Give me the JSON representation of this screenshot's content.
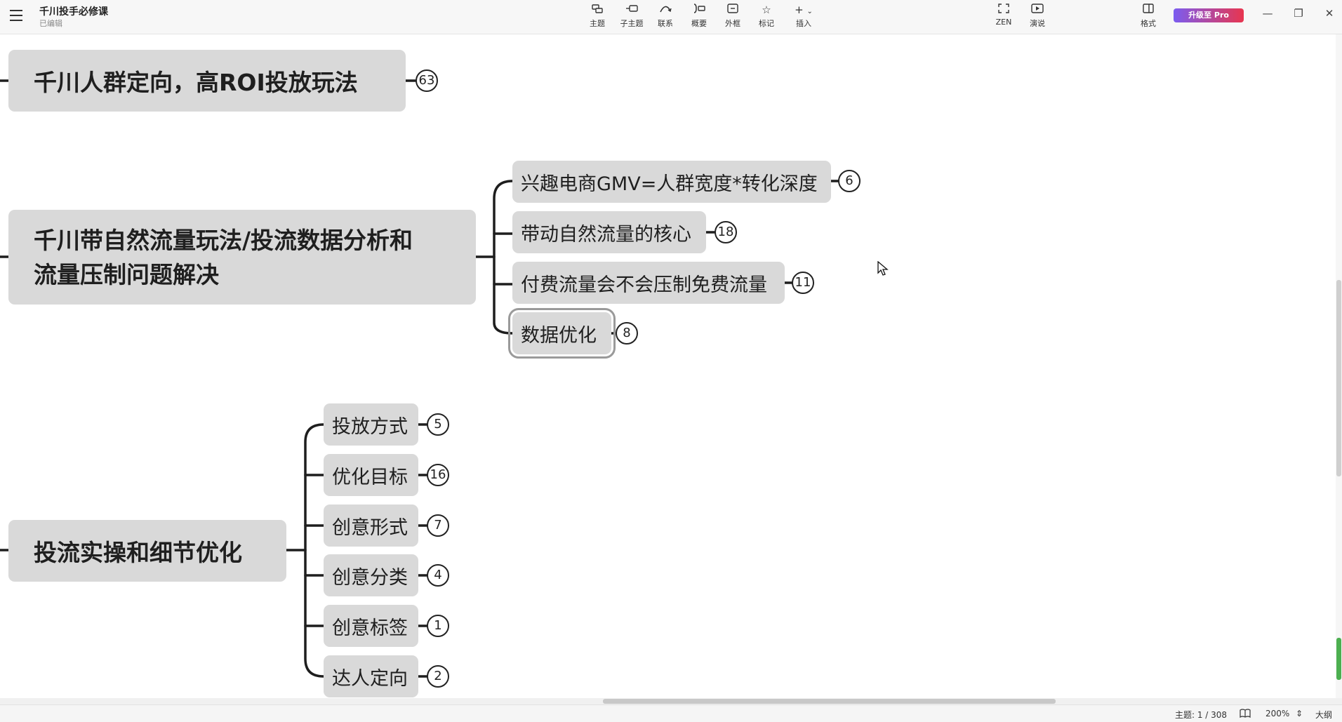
{
  "titlebar": {
    "document_title": "千川投手必修课",
    "save_status": "已编辑"
  },
  "toolbar": {
    "tools": [
      {
        "label": "主题",
        "icon": "topic-icon"
      },
      {
        "label": "子主题",
        "icon": "subtopic-icon"
      },
      {
        "label": "联系",
        "icon": "relationship-icon"
      },
      {
        "label": "概要",
        "icon": "summary-icon"
      },
      {
        "label": "外框",
        "icon": "boundary-icon"
      },
      {
        "label": "标记",
        "icon": "star-icon"
      },
      {
        "label": "插入",
        "icon": "plus-icon"
      }
    ],
    "zen_label": "ZEN",
    "present_label": "演说",
    "format_label": "格式",
    "upgrade_label": "升级至 Pro"
  },
  "mindmap": {
    "branch1": {
      "title": "千川人群定向，高ROI投放玩法",
      "count": "63"
    },
    "branch2": {
      "title_line1": "千川带自然流量玩法/投流数据分析和",
      "title_line2": "流量压制问题解决",
      "children": [
        {
          "label": "兴趣电商GMV=人群宽度*转化深度",
          "count": "6"
        },
        {
          "label": "带动自然流量的核心",
          "count": "18"
        },
        {
          "label": "付费流量会不会压制免费流量",
          "count": "11"
        },
        {
          "label": "数据优化",
          "count": "8",
          "selected": true
        }
      ]
    },
    "branch3": {
      "title": "投流实操和细节优化",
      "children": [
        {
          "label": "投放方式",
          "count": "5"
        },
        {
          "label": "优化目标",
          "count": "16"
        },
        {
          "label": "创意形式",
          "count": "7"
        },
        {
          "label": "创意分类",
          "count": "4"
        },
        {
          "label": "创意标签",
          "count": "1"
        },
        {
          "label": "达人定向",
          "count": "2"
        }
      ]
    }
  },
  "statusbar": {
    "topic_count": "主题: 1 / 308",
    "zoom": "200%",
    "outline_label": "大纲"
  }
}
